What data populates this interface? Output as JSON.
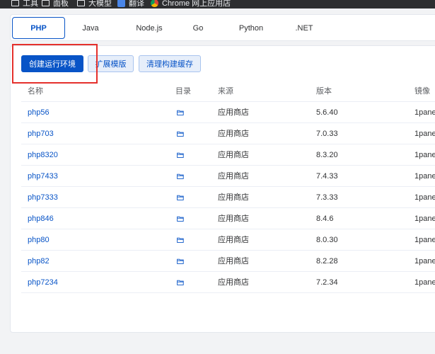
{
  "bookmarks": [
    {
      "label": "工具",
      "icon": "folder-icon"
    },
    {
      "label": "面板",
      "icon": "folder-icon"
    },
    {
      "label": "大模型",
      "icon": "folder-icon"
    },
    {
      "label": "翻译",
      "icon": "translate-app-icon"
    },
    {
      "label": "Chrome 网上应用店",
      "icon": "chrome-webstore-icon"
    }
  ],
  "tabs": [
    "PHP",
    "Java",
    "Node.js",
    "Go",
    "Python",
    ".NET"
  ],
  "active_tab": "PHP",
  "toolbar": {
    "create_label": "创建运行环境",
    "extend_label": "扩展模版",
    "clean_label": "清理构建缓存"
  },
  "table": {
    "headers": {
      "name": "名称",
      "dir": "目录",
      "source": "来源",
      "version": "版本",
      "image": "镜像"
    },
    "rows": [
      {
        "name": "php56",
        "source": "应用商店",
        "version": "5.6.40",
        "image": "1pane"
      },
      {
        "name": "php703",
        "source": "应用商店",
        "version": "7.0.33",
        "image": "1pane"
      },
      {
        "name": "php8320",
        "source": "应用商店",
        "version": "8.3.20",
        "image": "1pane"
      },
      {
        "name": "php7433",
        "source": "应用商店",
        "version": "7.4.33",
        "image": "1pane"
      },
      {
        "name": "php7333",
        "source": "应用商店",
        "version": "7.3.33",
        "image": "1pane"
      },
      {
        "name": "php846",
        "source": "应用商店",
        "version": "8.4.6",
        "image": "1pane"
      },
      {
        "name": "php80",
        "source": "应用商店",
        "version": "8.0.30",
        "image": "1pane"
      },
      {
        "name": "php82",
        "source": "应用商店",
        "version": "8.2.28",
        "image": "1pane"
      },
      {
        "name": "php7234",
        "source": "应用商店",
        "version": "7.2.34",
        "image": "1pane"
      }
    ]
  },
  "colors": {
    "accent": "#0854c7",
    "highlight_box": "#e5302c"
  }
}
